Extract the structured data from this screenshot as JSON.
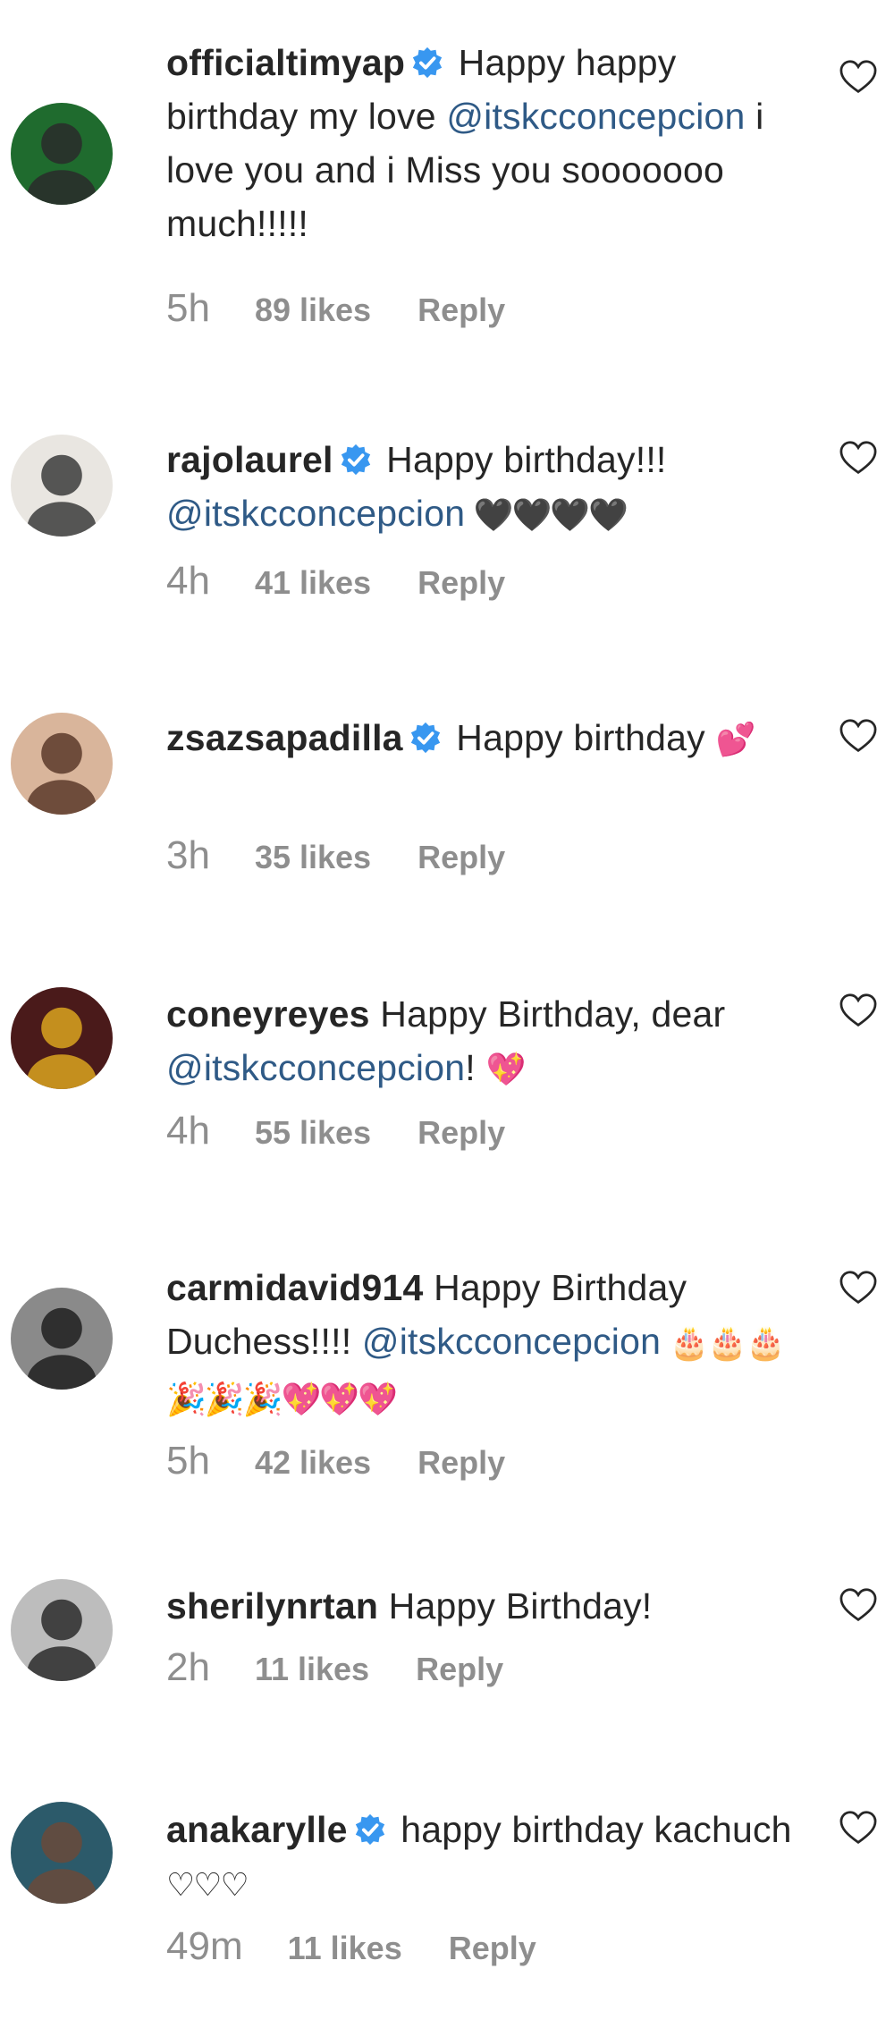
{
  "comments": [
    {
      "username": "officialtimyap",
      "verified": true,
      "segments": [
        {
          "t": "text",
          "v": " Happy happy birthday my love "
        },
        {
          "t": "mention",
          "v": "@itskcconcepcion"
        },
        {
          "t": "text",
          "v": " i love you and i Miss you sooooooo much!!!!!"
        }
      ],
      "time": "5h",
      "likes": "89 likes",
      "reply": "Reply",
      "avatar_colors": [
        "#1f6b2e",
        "#2a2a2a"
      ]
    },
    {
      "username": "rajolaurel",
      "verified": true,
      "segments": [
        {
          "t": "text",
          "v": " Happy birthday!!! "
        },
        {
          "t": "mention",
          "v": "@itskcconcepcion"
        },
        {
          "t": "emoji",
          "v": " 🖤🖤🖤🖤"
        }
      ],
      "time": "4h",
      "likes": "41 likes",
      "reply": "Reply",
      "avatar_colors": [
        "#e9e6e1",
        "#3b3b3b"
      ]
    },
    {
      "username": "zsazsapadilla",
      "verified": true,
      "segments": [
        {
          "t": "text",
          "v": " Happy birthday "
        },
        {
          "t": "emoji",
          "v": "💕"
        }
      ],
      "time": "3h",
      "likes": "35 likes",
      "reply": "Reply",
      "avatar_colors": [
        "#d9b59b",
        "#5a3a2a"
      ]
    },
    {
      "username": "coneyreyes",
      "verified": false,
      "segments": [
        {
          "t": "text",
          "v": " Happy Birthday, dear "
        },
        {
          "t": "mention",
          "v": "@itskcconcepcion"
        },
        {
          "t": "text",
          "v": "! "
        },
        {
          "t": "emoji",
          "v": "💖"
        }
      ],
      "time": "4h",
      "likes": "55 likes",
      "reply": "Reply",
      "avatar_colors": [
        "#4a1a1a",
        "#d9a520"
      ]
    },
    {
      "username": "carmidavid914",
      "verified": false,
      "segments": [
        {
          "t": "text",
          "v": " Happy Birthday Duchess!!!! "
        },
        {
          "t": "mention",
          "v": "@itskcconcepcion"
        },
        {
          "t": "emoji",
          "v": " 🎂🎂🎂🎉🎉🎉💖💖💖"
        }
      ],
      "time": "5h",
      "likes": "42 likes",
      "reply": "Reply",
      "avatar_colors": [
        "#8a8a8a",
        "#1f1f1f"
      ]
    },
    {
      "username": "sherilynrtan",
      "verified": false,
      "segments": [
        {
          "t": "text",
          "v": " Happy Birthday!"
        }
      ],
      "time": "2h",
      "likes": "11 likes",
      "reply": "Reply",
      "avatar_colors": [
        "#bdbdbd",
        "#2b2b2b"
      ]
    },
    {
      "username": "anakarylle",
      "verified": true,
      "segments": [
        {
          "t": "text",
          "v": " happy birthday kachuch "
        },
        {
          "t": "emoji",
          "v": "♡♡♡"
        }
      ],
      "time": "49m",
      "likes": "11 likes",
      "reply": "Reply",
      "avatar_colors": [
        "#2c5a6a",
        "#6a4a3a"
      ]
    }
  ],
  "icons": {
    "verified": "verified-badge-icon",
    "like": "heart-icon"
  },
  "colors": {
    "username": "#262626",
    "mention": "#2f5a86",
    "meta": "#8e8e8e",
    "verified": "#3897f0"
  }
}
